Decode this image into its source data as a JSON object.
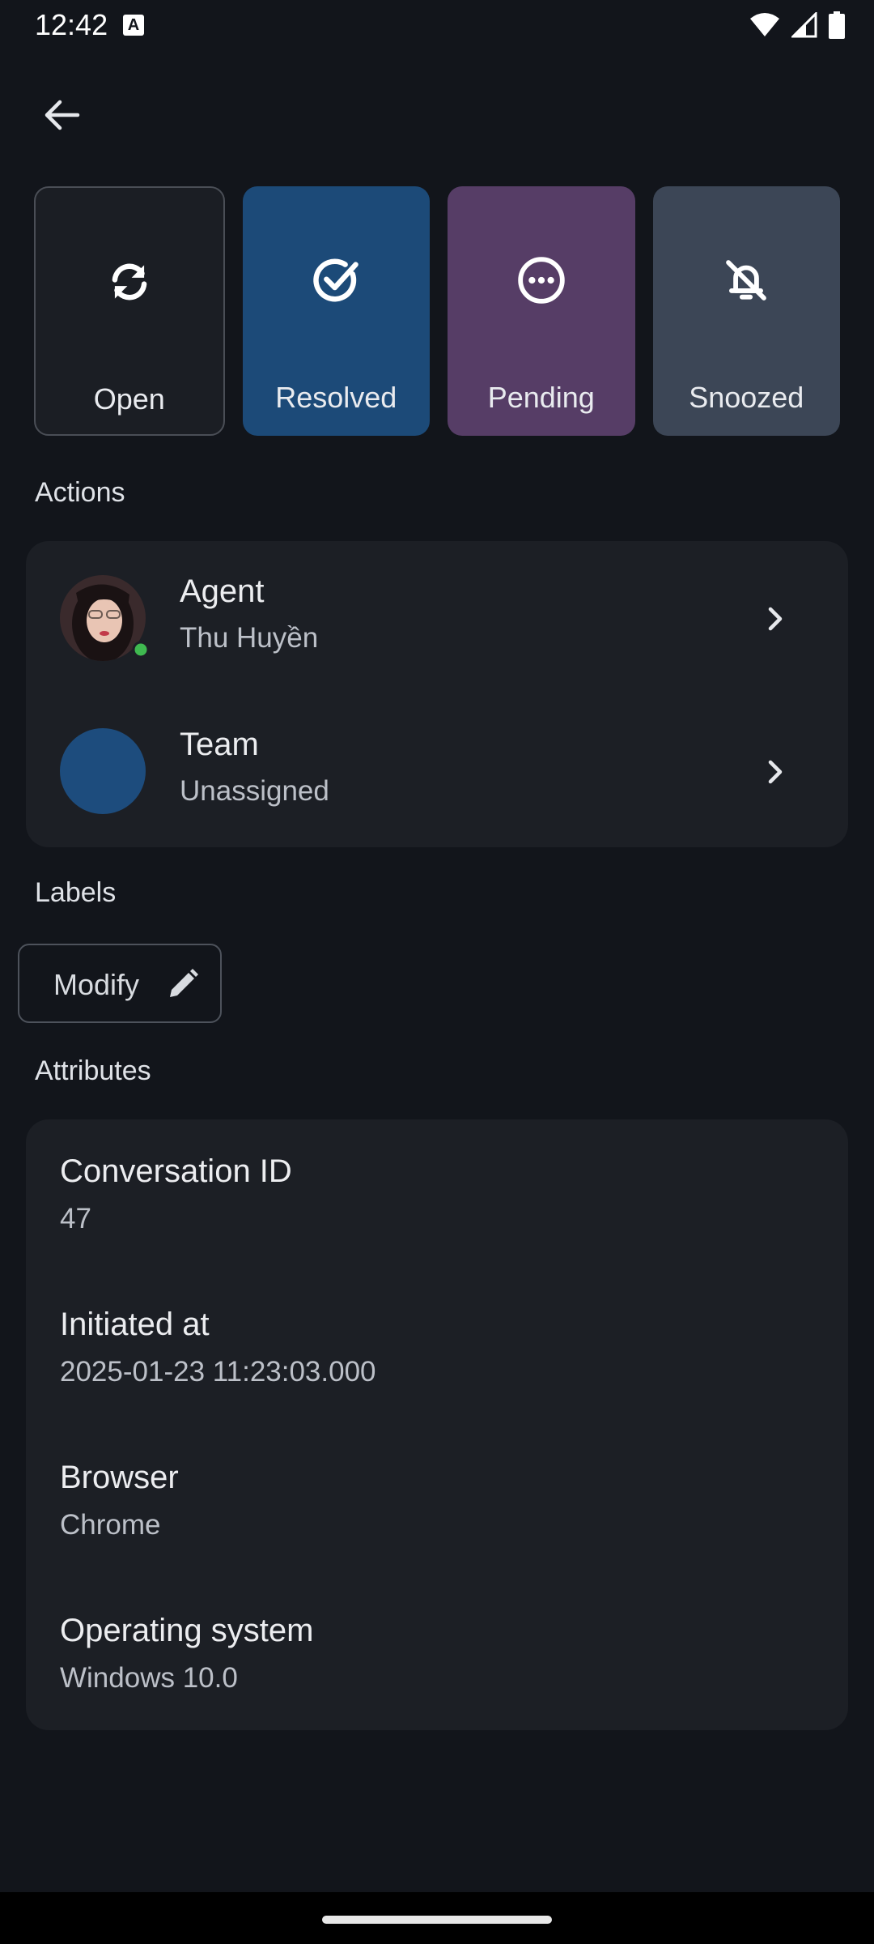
{
  "status_bar": {
    "time": "12:42",
    "a_icon_label": "A"
  },
  "status_options": [
    {
      "label": "Open",
      "icon": "refresh-icon"
    },
    {
      "label": "Resolved",
      "icon": "check-circle-icon"
    },
    {
      "label": "Pending",
      "icon": "more-circle-icon"
    },
    {
      "label": "Snoozed",
      "icon": "bell-off-icon"
    }
  ],
  "actions": {
    "title": "Actions",
    "agent": {
      "label": "Agent",
      "value": "Thu Huyền"
    },
    "team": {
      "label": "Team",
      "value": "Unassigned"
    }
  },
  "labels": {
    "title": "Labels",
    "modify_label": "Modify"
  },
  "attributes": {
    "title": "Attributes",
    "items": [
      {
        "name": "Conversation ID",
        "value": "47"
      },
      {
        "name": "Initiated at",
        "value": "2025-01-23 11:23:03.000"
      },
      {
        "name": "Browser",
        "value": "Chrome"
      },
      {
        "name": "Operating system",
        "value": "Windows 10.0"
      }
    ]
  },
  "colors": {
    "background": "#12151b",
    "resolved": "#1c4a78",
    "pending": "#563d66",
    "snoozed": "#3c4656",
    "team_avatar": "#1d4c7d",
    "online": "#3fb950"
  }
}
